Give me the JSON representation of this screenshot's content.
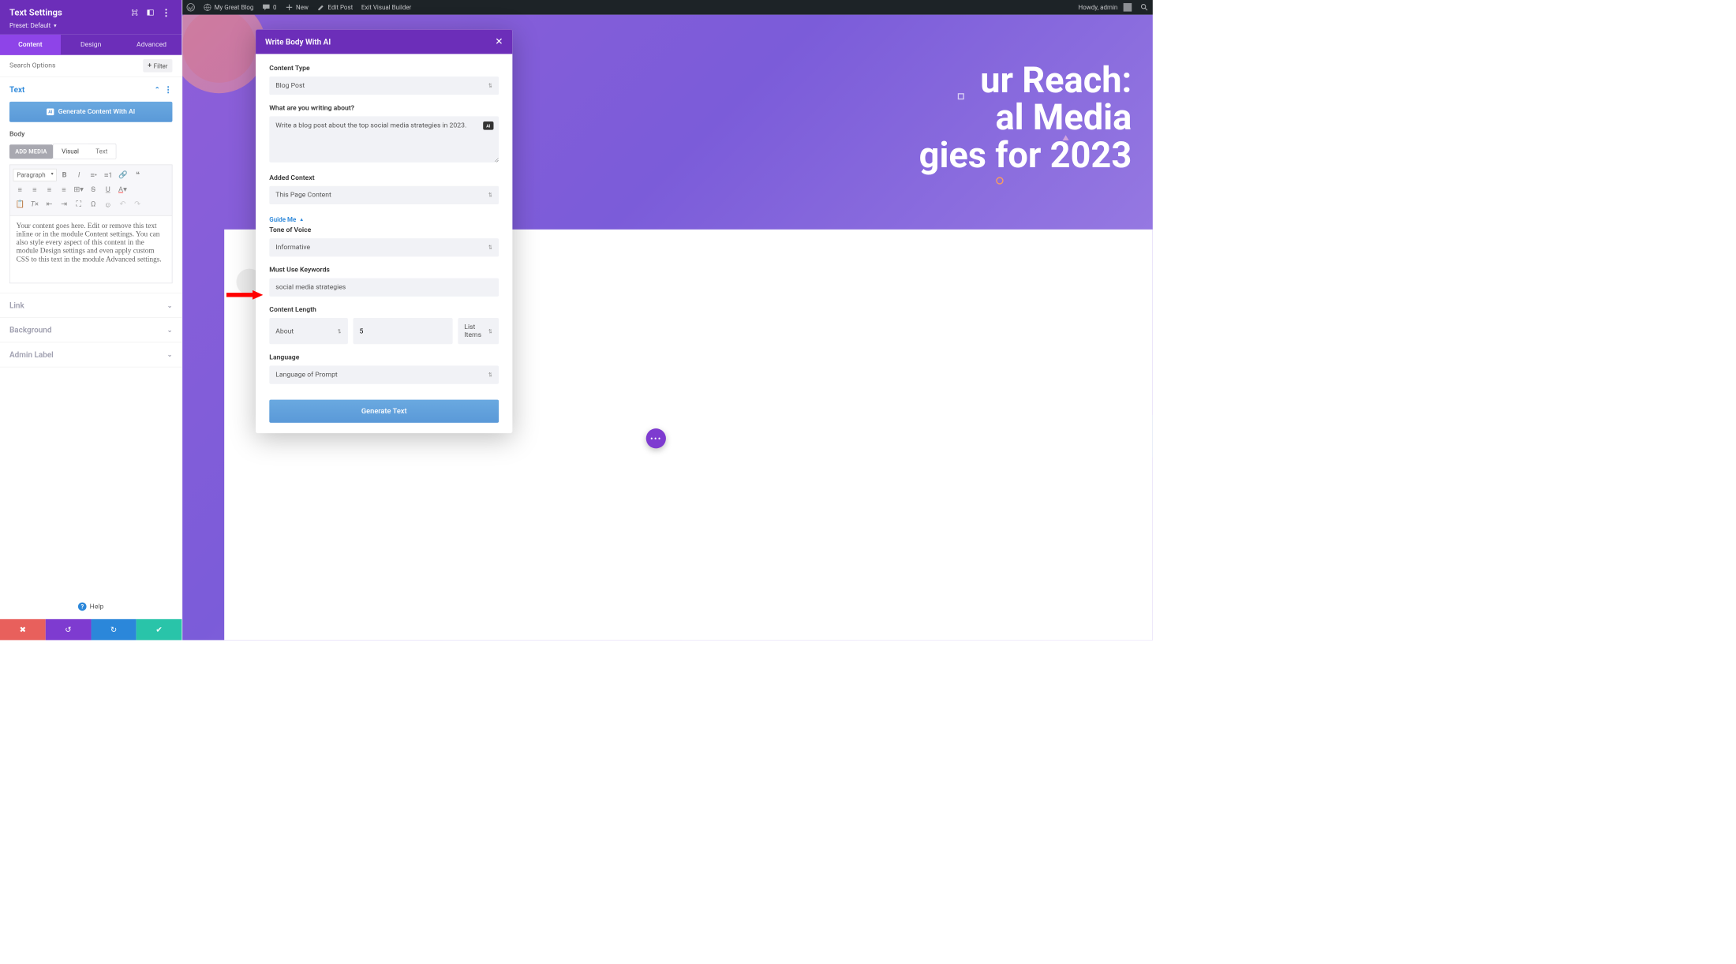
{
  "adminbar": {
    "site": "My Great Blog",
    "comments": "0",
    "new": "New",
    "edit": "Edit Post",
    "exit": "Exit Visual Builder",
    "howdy": "Howdy, admin"
  },
  "sidebar": {
    "title": "Text Settings",
    "preset_label": "Preset: Default",
    "tabs": {
      "content": "Content",
      "design": "Design",
      "advanced": "Advanced"
    },
    "search_placeholder": "Search Options",
    "filter": "Filter",
    "sections": {
      "text": "Text",
      "link": "Link",
      "background": "Background",
      "admin_label": "Admin Label"
    },
    "ai_button": "Generate Content With AI",
    "body_label": "Body",
    "add_media": "ADD MEDIA",
    "editor_tabs": {
      "visual": "Visual",
      "text": "Text"
    },
    "paragraph": "Paragraph",
    "sample_text": "Your content goes here. Edit or remove this text inline or in the module Content settings. You can also style every aspect of this content in the module Design settings and even apply custom CSS to this text in the module Advanced settings.",
    "help": "Help"
  },
  "page": {
    "headline_l1": "ur Reach:",
    "headline_l2": "al Media",
    "headline_l3": "gies for 2023"
  },
  "modal": {
    "title": "Write Body With AI",
    "content_type_label": "Content Type",
    "content_type_value": "Blog Post",
    "about_label": "What are you writing about?",
    "about_value": "Write a blog post about the top social media strategies in 2023.",
    "context_label": "Added Context",
    "context_value": "This Page Content",
    "guide": "Guide Me",
    "tone_label": "Tone of Voice",
    "tone_value": "Informative",
    "keywords_label": "Must Use Keywords",
    "keywords_value": "social media strategies",
    "length_label": "Content Length",
    "length_about": "About",
    "length_num": "5",
    "length_unit": "List Items",
    "lang_label": "Language",
    "lang_value": "Language of Prompt",
    "generate": "Generate Text"
  }
}
